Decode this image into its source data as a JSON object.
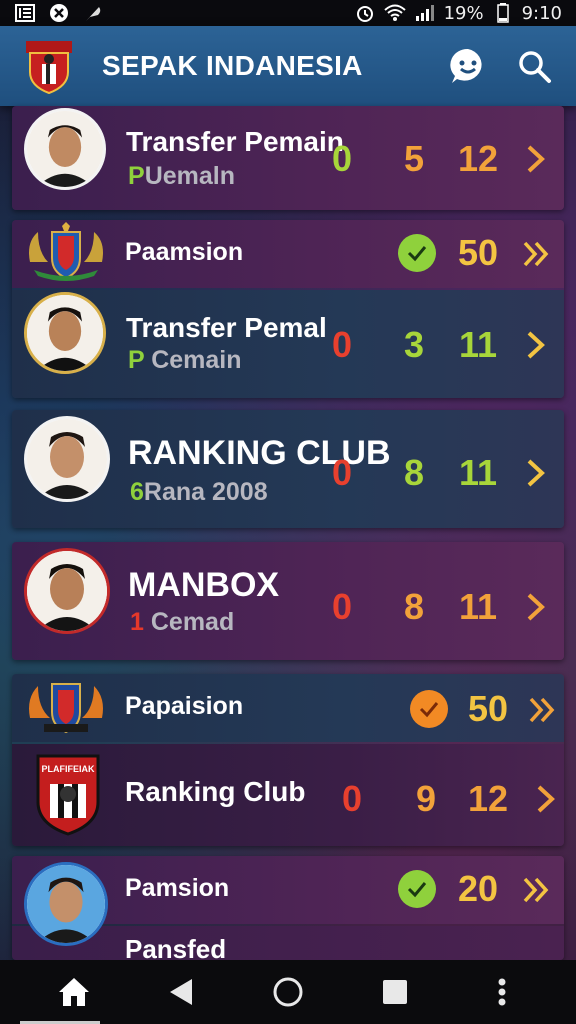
{
  "status": {
    "battery": "19%",
    "time": "9:10"
  },
  "app": {
    "title": "SEPAK INDANESIA"
  },
  "rows": [
    {
      "name": "Transfer Pemain",
      "sub_prefix": "P",
      "sub": "Uemaln",
      "n1": "0",
      "n2": "5",
      "n3": "12"
    },
    {
      "name": "Paamsion",
      "check": "green",
      "score": "50"
    },
    {
      "name": "Transfer Pemal",
      "sub_prefix": "P",
      "sub": "Cemain",
      "n1": "0",
      "n2": "3",
      "n3": "11"
    },
    {
      "name": "RANKING CLUB",
      "sub_prefix": "6",
      "sub": "Rana 2008",
      "n1": "0",
      "n2": "8",
      "n3": "11"
    },
    {
      "name": "MANBOX",
      "sub_prefix": "1",
      "sub": "Cemad",
      "n1": "0",
      "n2": "8",
      "n3": "11"
    },
    {
      "name": "Papaision",
      "check": "orange",
      "score": "50"
    },
    {
      "name": "Ranking Club",
      "n1": "0",
      "n2": "9",
      "n3": "12",
      "badge": "PLAFIFEIAK"
    },
    {
      "name": "Pamsion",
      "check": "green",
      "score": "20"
    },
    {
      "name": "Pansfed"
    }
  ],
  "colors": {
    "appbar": "#2c6396",
    "green": "#a8d63a",
    "orange": "#f2a23a",
    "red": "#e8402e"
  },
  "icons": [
    "notification-icon",
    "close-icon",
    "feather-icon",
    "alarm-icon",
    "wifi-icon",
    "signal-icon",
    "battery-icon",
    "club-logo",
    "chat-icon",
    "search-icon",
    "home-icon",
    "back-icon",
    "circle-home-icon",
    "recents-icon",
    "more-icon"
  ]
}
